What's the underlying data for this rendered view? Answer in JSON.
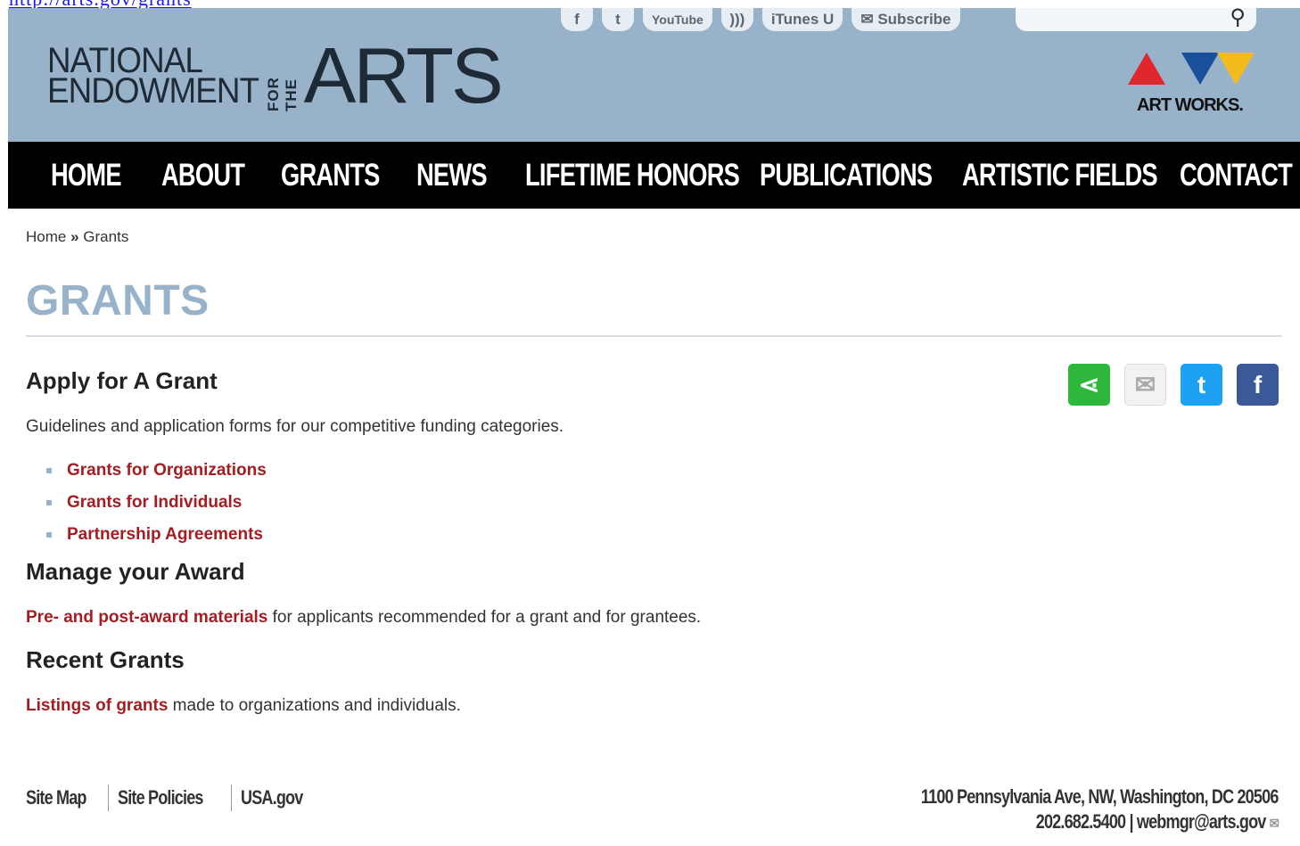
{
  "url_text": "http://arts.gov/grants",
  "header": {
    "logo": {
      "line1": "NATIONAL",
      "line2": "ENDOWMENT",
      "for_the": "FOR THE",
      "arts": "ARTS"
    },
    "social": {
      "facebook": "f",
      "twitter": "t",
      "youtube": "YouTube",
      "rss": "rss",
      "itunes": "iTunes U",
      "subscribe": "Subscribe"
    },
    "search": {
      "placeholder": ""
    },
    "artworks": "ART WORKS."
  },
  "nav": [
    "HOME",
    "ABOUT",
    "GRANTS",
    "NEWS",
    "LIFETIME HONORS",
    "PUBLICATIONS",
    "ARTISTIC FIELDS",
    "CONTACT"
  ],
  "breadcrumb": {
    "home": "Home",
    "sep": "»",
    "current": "Grants"
  },
  "page_title": "GRANTS",
  "sections": {
    "apply": {
      "heading": "Apply for A Grant",
      "desc": "Guidelines and application forms for our competitive funding categories.",
      "links": [
        "Grants for Organizations",
        "Grants for Individuals",
        "Partnership Agreements"
      ]
    },
    "manage": {
      "heading": "Manage your Award",
      "link": "Pre- and post-award materials",
      "rest": " for applicants recommended for a grant and for grantees."
    },
    "recent": {
      "heading": "Recent Grants",
      "link": "Listings of grants",
      "rest": " made to organizations and individuals."
    }
  },
  "footer": {
    "links": [
      "Site Map",
      "Site Policies",
      "USA.gov"
    ],
    "address": "1100 Pennsylvania Ave, NW, Washington, DC 20506",
    "phone": "202.682.5400",
    "email": "webmgr@arts.gov"
  },
  "colors": {
    "header_bg": "#98b2c9",
    "link": "#a51d22",
    "nav_bg": "#000000"
  }
}
